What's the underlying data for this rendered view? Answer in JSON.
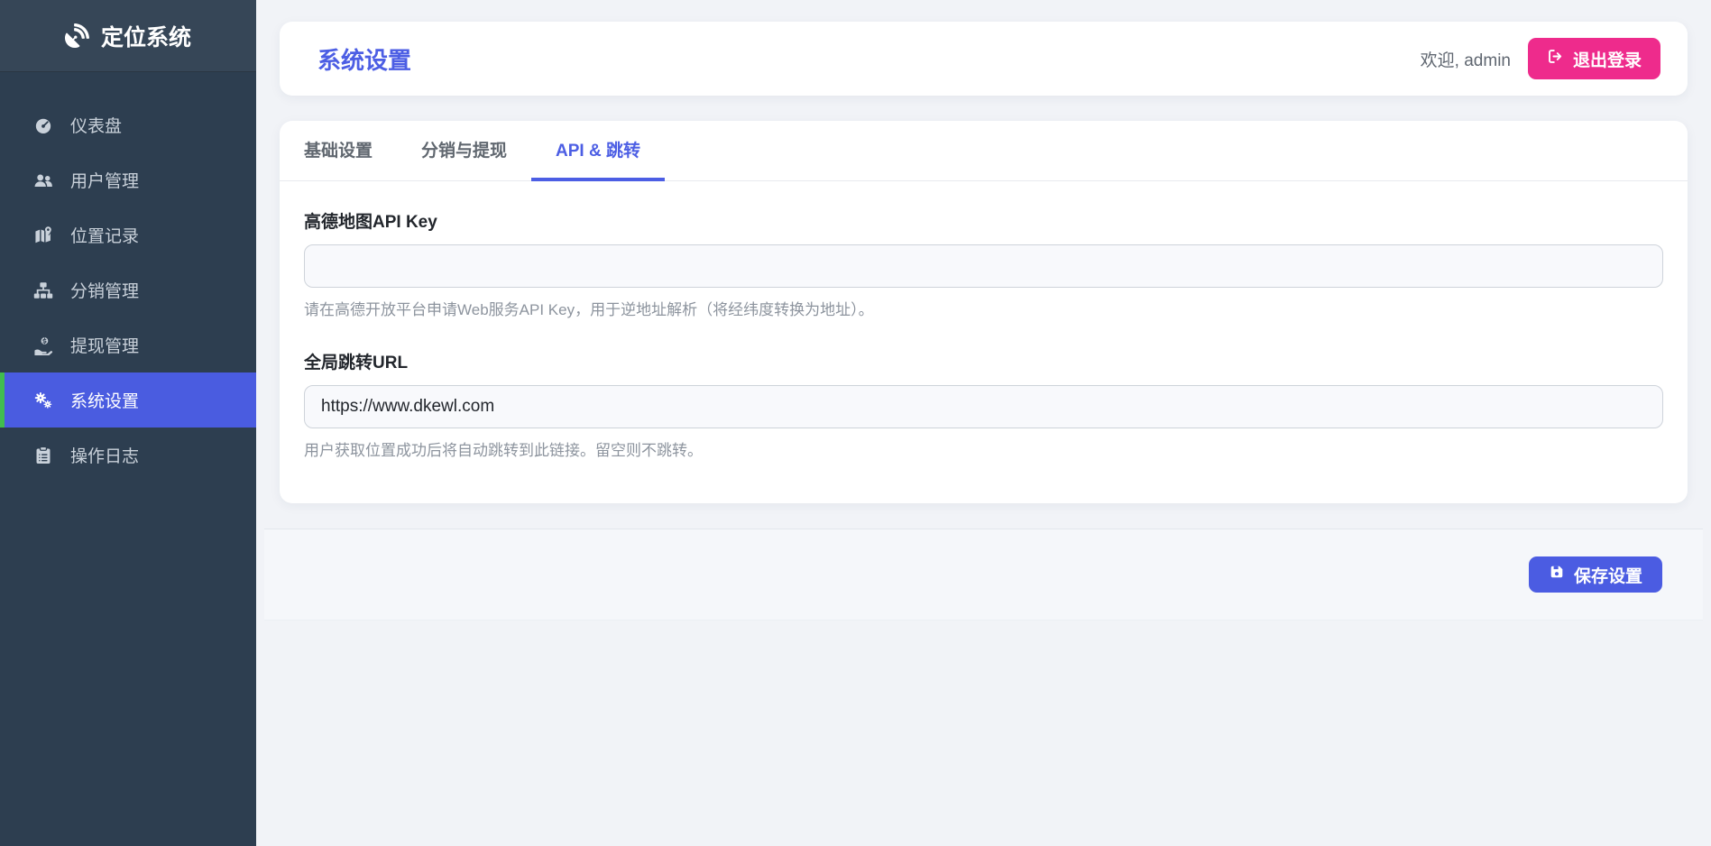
{
  "app": {
    "name": "定位系统"
  },
  "sidebar": {
    "items": [
      {
        "label": "仪表盘"
      },
      {
        "label": "用户管理"
      },
      {
        "label": "位置记录"
      },
      {
        "label": "分销管理"
      },
      {
        "label": "提现管理"
      },
      {
        "label": "系统设置"
      },
      {
        "label": "操作日志"
      }
    ]
  },
  "header": {
    "title": "系统设置",
    "welcome": "欢迎, admin",
    "logout_label": "退出登录"
  },
  "settings": {
    "tabs": [
      {
        "label": "基础设置"
      },
      {
        "label": "分销与提现"
      },
      {
        "label": "API & 跳转"
      }
    ],
    "fields": [
      {
        "label": "高德地图API Key",
        "value": "",
        "help": "请在高德开放平台申请Web服务API Key，用于逆地址解析（将经纬度转换为地址）。"
      },
      {
        "label": "全局跳转URL",
        "value": "https://www.dkewl.com",
        "help": "用户获取位置成功后将自动跳转到此链接。留空则不跳转。"
      }
    ],
    "save_label": "保存设置"
  },
  "colors": {
    "accent_blue": "#4c5ee4",
    "accent_pink": "#ee2b8c",
    "active_item_green_border": "#41bd4f",
    "sidebar_bg": "#2d3e50",
    "page_bg": "#f1f3f7"
  }
}
